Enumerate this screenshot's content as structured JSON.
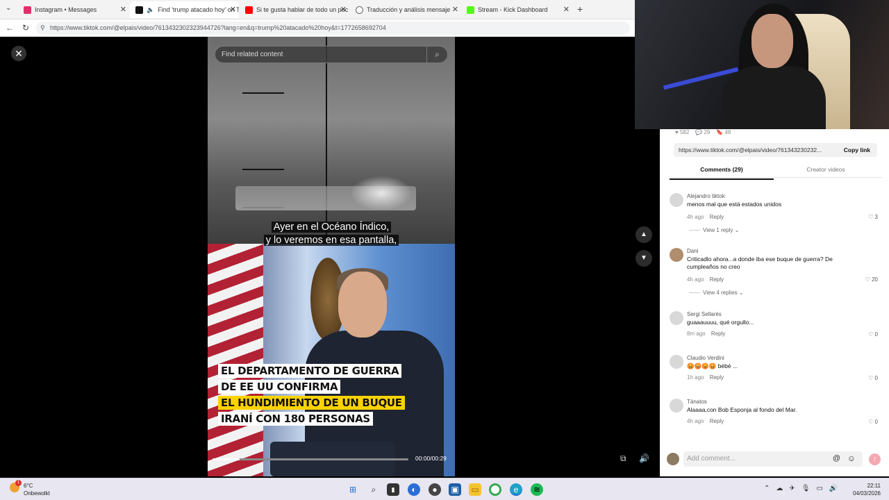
{
  "browser": {
    "tabs": [
      {
        "label": "Instagram • Messages",
        "favicon_color": "#e1306c",
        "active": false
      },
      {
        "label": "Find 'trump atacado hoy' on T",
        "favicon_color": "#111111",
        "active": true
      },
      {
        "label": "Si te gusta hablar de todo un poc",
        "favicon_color": "#ff0000",
        "active": false
      },
      {
        "label": "Traducción y análisis mensaje",
        "favicon_color": "#666666",
        "active": false
      },
      {
        "label": "Stream - Kick Dashboard",
        "favicon_color": "#53fc18",
        "active": false
      }
    ],
    "new_tab": "+",
    "url": "https://www.tiktok.com/@elpais/video/7613432302323944726?lang=en&q=trump%20atacado%20hoy&t=1772658692704"
  },
  "video": {
    "search_placeholder": "Find related content",
    "subtitle_line1": "Ayer en el Océano Índico,",
    "subtitle_line2": "y lo veremos en esa pantalla,",
    "caption_lines": [
      "EL DEPARTAMENTO DE GUERRA",
      "DE EE UU CONFIRMA",
      "EL HUNDIMIENTO DE UN BUQUE",
      "IRANÍ CON 180 PERSONAS"
    ],
    "time": "00:00/00:29",
    "progress": 0.14
  },
  "panel": {
    "actions": {
      "likes": "582",
      "comments": "29",
      "saves": "48"
    },
    "link": "https://www.tiktok.com/@elpais/video/761343230232...",
    "copy_link": "Copy link",
    "tab_comments": "Comments (29)",
    "tab_creator": "Creator videos",
    "comments": [
      {
        "name": "Alejandro tiktok",
        "text": "menos mal que está estados unidos",
        "time": "4h ago",
        "reply": "Reply",
        "likes": "3",
        "replies": "View 1 reply"
      },
      {
        "name": "Dani",
        "text": "Criticadlo ahora...a donde iba ese buque de guerra? De cumpleaños no creo",
        "time": "4h ago",
        "reply": "Reply",
        "likes": "20",
        "replies": "View 4 replies"
      },
      {
        "name": "Sergi Sellarés",
        "text": "guaaauuuu, qué orgullo...",
        "time": "8m ago",
        "reply": "Reply",
        "likes": "0",
        "replies": ""
      },
      {
        "name": "Claudio Verdini",
        "text": "😡😡😡😡 bébé ...",
        "time": "1h ago",
        "reply": "Reply",
        "likes": "0",
        "replies": ""
      },
      {
        "name": "Tánatos",
        "text": "Alaaaa,con Bob Esponja al fondo del Mar.",
        "time": "4h ago",
        "reply": "Reply",
        "likes": "0",
        "replies": ""
      }
    ],
    "add_comment": "Add comment..."
  },
  "taskbar": {
    "weather_temp": "6°C",
    "weather_cond": "Onbewolkt",
    "notification_count": "1",
    "time": "22:11",
    "date": "04/03/2026"
  }
}
